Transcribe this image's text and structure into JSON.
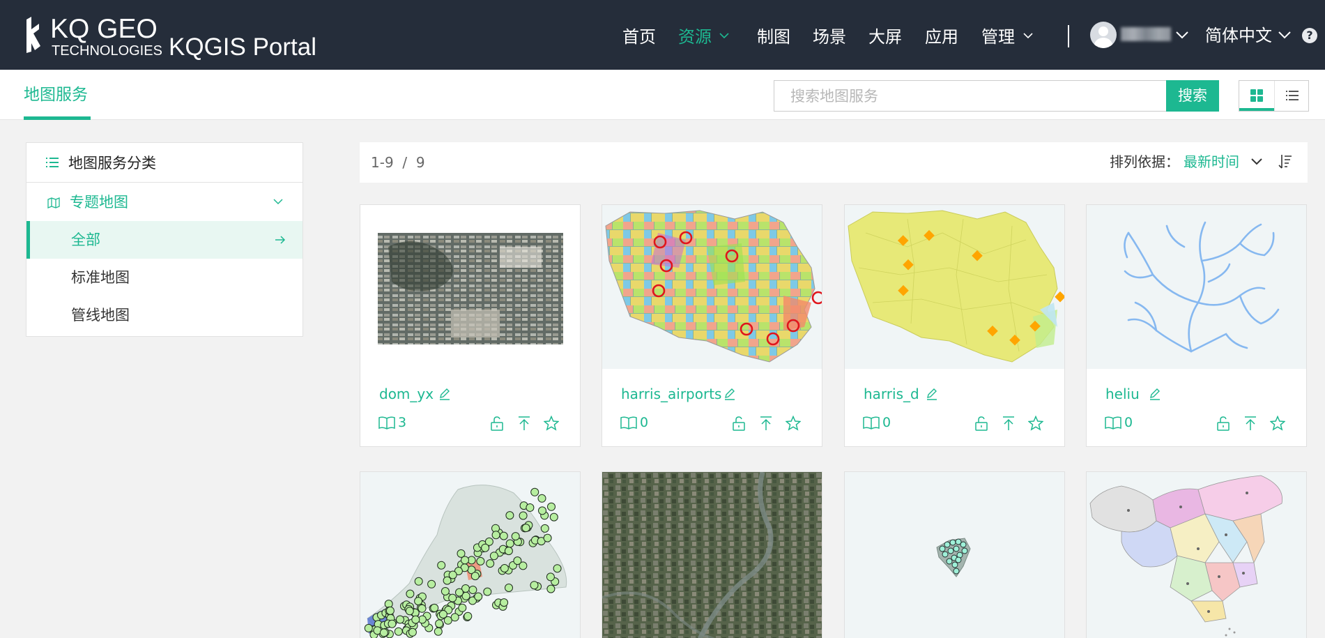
{
  "header": {
    "logo_line1": "KQ GEO",
    "logo_line2": "TECHNOLOGIES",
    "portal_title": "KQGIS Portal",
    "nav": [
      {
        "label": "首页"
      },
      {
        "label": "资源"
      },
      {
        "label": "制图"
      },
      {
        "label": "场景"
      },
      {
        "label": "大屏"
      },
      {
        "label": "应用"
      },
      {
        "label": "管理"
      }
    ],
    "active_nav": "资源",
    "language": "简体中文",
    "help": "?"
  },
  "subheader": {
    "title": "地图服务",
    "search_placeholder": "搜索地图服务",
    "search_button": "搜索",
    "view_mode": "grid"
  },
  "sidebar": {
    "heading": "地图服务分类",
    "group": "专题地图",
    "items": [
      {
        "label": "全部"
      },
      {
        "label": "标准地图"
      },
      {
        "label": "管线地图"
      }
    ],
    "active_item": "全部"
  },
  "results": {
    "range": "1-9",
    "separator": "/",
    "total": "9",
    "sort_label": "排列依据：",
    "sort_value": "最新时间"
  },
  "cards": [
    {
      "name": "dom_yx",
      "views": "3"
    },
    {
      "name": "harris_airports",
      "views": "0"
    },
    {
      "name": "harris_d",
      "views": "0"
    },
    {
      "name": "heliu",
      "views": "0"
    },
    {
      "name": "",
      "views": ""
    },
    {
      "name": "",
      "views": ""
    },
    {
      "name": "",
      "views": ""
    },
    {
      "name": "",
      "views": ""
    }
  ],
  "colors": {
    "accent": "#1db891",
    "nav_bg": "#252d3a",
    "page_bg": "#f2f2f2"
  }
}
